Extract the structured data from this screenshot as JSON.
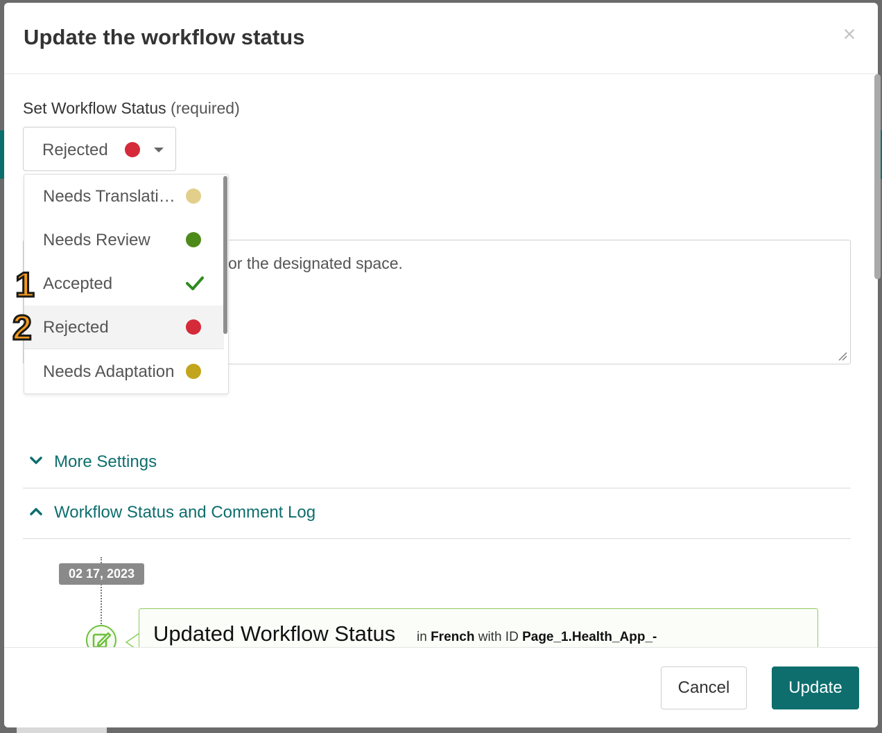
{
  "modal": {
    "title": "Update the workflow status",
    "close_symbol": "×"
  },
  "status_field": {
    "label": "Set Workflow Status",
    "required_label": "(required)",
    "selected_value": "Rejected",
    "selected_color": "#d42a3a",
    "options": [
      {
        "label": "Needs Translation",
        "color": "#e3cf8c",
        "marker": "dot"
      },
      {
        "label": "Needs Review",
        "color": "#4e8a1a",
        "marker": "dot"
      },
      {
        "label": "Accepted",
        "color": "#2e8b1e",
        "marker": "check-icon"
      },
      {
        "label": "Rejected",
        "color": "#d42a3a",
        "marker": "dot"
      },
      {
        "label": "Needs Adaptation",
        "color": "#c2a51c",
        "marker": "dot"
      }
    ]
  },
  "comment": {
    "visible_text": "or the designated space."
  },
  "annotations": {
    "one": "1",
    "two": "2"
  },
  "sections": {
    "more_settings": "More Settings",
    "log": "Workflow Status and Comment Log"
  },
  "log": {
    "date": "02 17, 2023",
    "entry_title": "Updated Workflow Status",
    "in_word": "in",
    "language": "French",
    "with_id_word": "with ID",
    "id_value": "Page_1.Health_App_-"
  },
  "footer": {
    "cancel_label": "Cancel",
    "update_label": "Update"
  },
  "colors": {
    "accent": "#0e6e6e",
    "log_border": "#8dcc5d"
  }
}
